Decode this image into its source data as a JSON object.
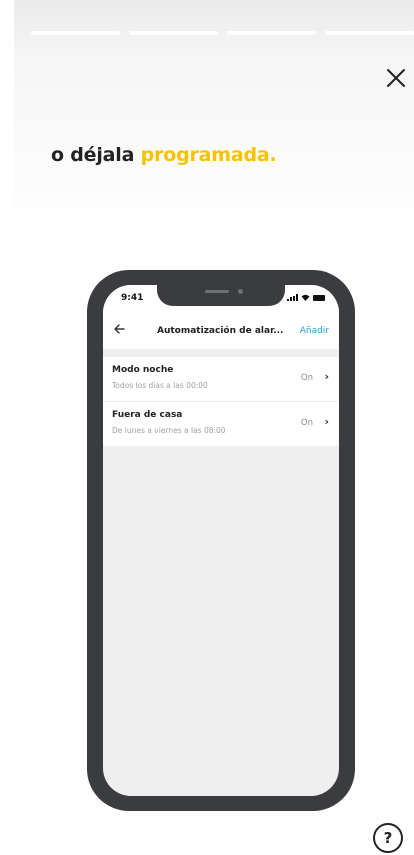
{
  "headline": {
    "prefix": "o déjala ",
    "accent": "programada."
  },
  "colors": {
    "accent": "#f6c300",
    "link": "#2f9be0",
    "phone_frame": "#3b3c3f"
  },
  "help_label": "?",
  "progress": {
    "segments": 4,
    "active_index": 0
  },
  "phone": {
    "status_time": "9:41",
    "nav": {
      "back_icon": "arrow-left-icon",
      "title": "Automatización de alar...",
      "action": "Añadir"
    },
    "rows": [
      {
        "title": "Modo noche",
        "subtitle": "Todos los días a las 00:00",
        "status": "On"
      },
      {
        "title": "Fuera de casa",
        "subtitle": "De lunes a viernes a las 08:00",
        "status": "On"
      }
    ]
  }
}
